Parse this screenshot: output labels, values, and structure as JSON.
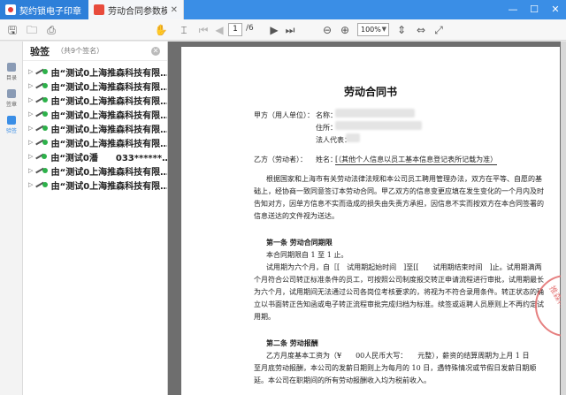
{
  "tabs": [
    {
      "label": "契约锁电子印章",
      "closable": false
    },
    {
      "label": "劳动合同参数模版-目前...",
      "closable": true
    }
  ],
  "toolbar": {
    "page_current": "1",
    "page_total": "/6",
    "zoom": "100%"
  },
  "rail": [
    {
      "label": "目录"
    },
    {
      "label": "签章"
    },
    {
      "label": "验签"
    }
  ],
  "panel": {
    "title": "验签",
    "count": "（共9个签名）",
    "signatures": [
      "由“测试0上海推森科技有限…",
      "由“测试0上海推森科技有限…",
      "由“测试0上海推森科技有限…",
      "由“测试0上海推森科技有限…",
      "由“测试0上海推森科技有限…",
      "由“测试0上海推森科技有限…",
      "由“测试0潘　　033******…",
      "由“测试0上海推森科技有限…",
      "由“测试0上海推森科技有限…"
    ]
  },
  "doc": {
    "title": "劳动合同书",
    "party_a_label": "甲方（用人单位）：",
    "party_a_name": "名称：",
    "party_a_addr": "住所：",
    "party_a_rep": "法人代表：",
    "party_b_label": "乙方（劳动者）：",
    "party_b_name": "姓名：",
    "party_b_value": "[（其他个人信息以员工基本信息登记表所记载为准）",
    "intro": [
      "根据国家和上海市有关劳动法律法规和本公司员工聘用管理办法，双方在平等、自愿的基",
      "础上，经协商一致同意签订本劳动合同。甲乙双方的信息变更应填在发生变化的一个月内及时",
      "告知对方，因单方信息不实而造成的损失由失责方承担，因信息不实而按双方在本合同签署的",
      "信息送达的文件视为送达。"
    ],
    "art1_title": "第一条  劳动合同期限",
    "art1_l1": "本合同期限自 1 至 1 止。",
    "art1_l2": "试用期为六个月，自［[　试用期起始时间　]至[[　　试用期结束时间　]止。试用期满两",
    "art1_l3": "个月符合公司转正标准条件的员工，可按照公司制度报交转正申请流程进行审批，试用期最长",
    "art1_l4": "为六个月，试用期间无法通过公司各岗位考核要求的，将视为不符合录用条件。转正状态的确",
    "art1_l5": "立以书面转正告知函或电子转正流程审批完成归档为标准。续签或返聘人员原则上不再约定试",
    "art1_l6": "用期。",
    "art2_title": "第二条  劳动报酬",
    "art2_l1": "乙方月度基本工资为（¥　　00人民币大写：　　元整），薪资的结算周期为上月 1 日",
    "art2_l2": "至月底劳动报酬，本公司的发薪日期则上为每月的 10 日，遇特殊情况或节假日发薪日期顺",
    "art2_l3": "延。本公司在职期间的所有劳动报酬收入均为税前收入。",
    "seal_text": "推森科技"
  }
}
